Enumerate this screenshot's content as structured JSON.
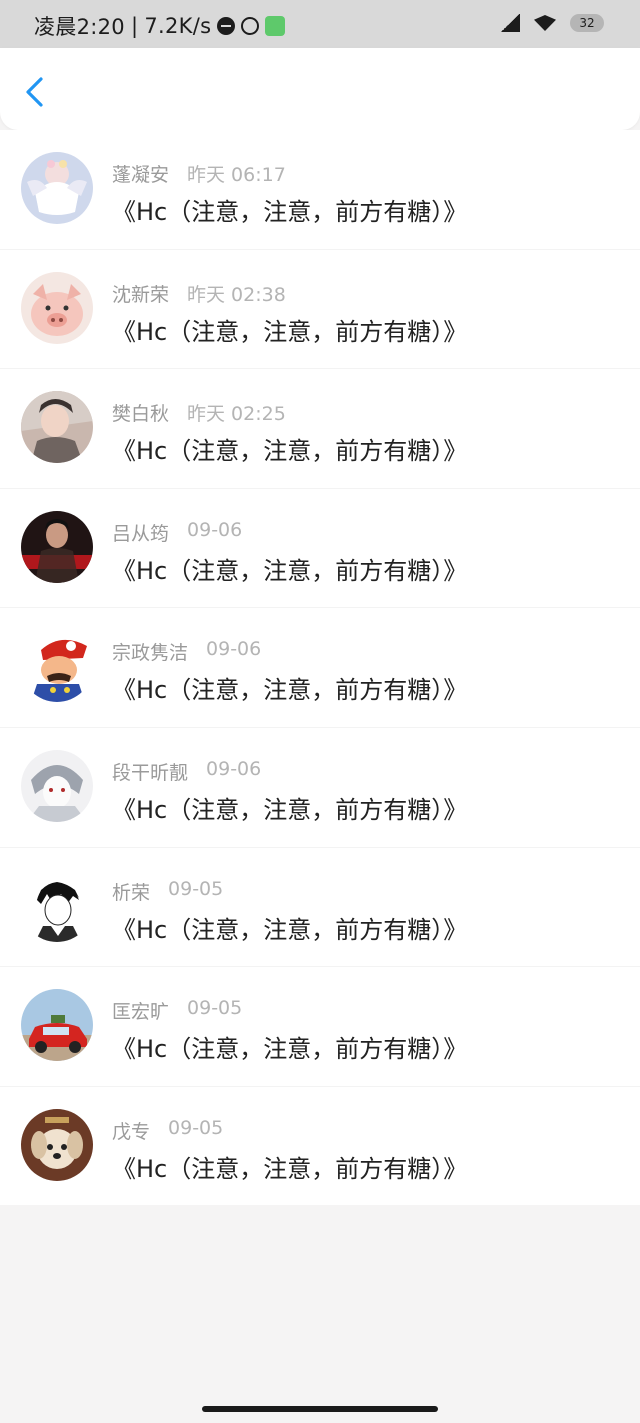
{
  "status_bar": {
    "time": "凌晨2:20",
    "separator": "|",
    "speed": "7.2K/s",
    "battery": "32"
  },
  "nav": {
    "back_icon": "chevron-left-icon",
    "accent_color": "#2196F3"
  },
  "comments": [
    {
      "name": "蓬凝安",
      "time": "昨天 06:17",
      "message": "《Hc（注意，注意，前方有糖）》",
      "avatar": "angel-avatar"
    },
    {
      "name": "沈新荣",
      "time": "昨天 02:38",
      "message": "《Hc（注意，注意，前方有糖）》",
      "avatar": "pig-avatar"
    },
    {
      "name": "樊白秋",
      "time": "昨天 02:25",
      "message": "《Hc（注意，注意，前方有糖）》",
      "avatar": "boy-photo-avatar"
    },
    {
      "name": "吕从筠",
      "time": "09-06",
      "message": "《Hc（注意，注意，前方有糖）》",
      "avatar": "dark-photo-avatar"
    },
    {
      "name": "宗政隽洁",
      "time": "09-06",
      "message": "《Hc（注意，注意，前方有糖）》",
      "avatar": "mario-avatar"
    },
    {
      "name": "段干昕靓",
      "time": "09-06",
      "message": "《Hc（注意，注意，前方有糖）》",
      "avatar": "anime-sketch-avatar"
    },
    {
      "name": "析荣",
      "time": "09-05",
      "message": "《Hc（注意，注意，前方有糖）》",
      "avatar": "anime-boy-avatar"
    },
    {
      "name": "匡宏旷",
      "time": "09-05",
      "message": "《Hc（注意，注意，前方有糖）》",
      "avatar": "red-car-avatar"
    },
    {
      "name": "戊专",
      "time": "09-05",
      "message": "《Hc（注意，注意，前方有糖）》",
      "avatar": "puppy-avatar"
    }
  ]
}
